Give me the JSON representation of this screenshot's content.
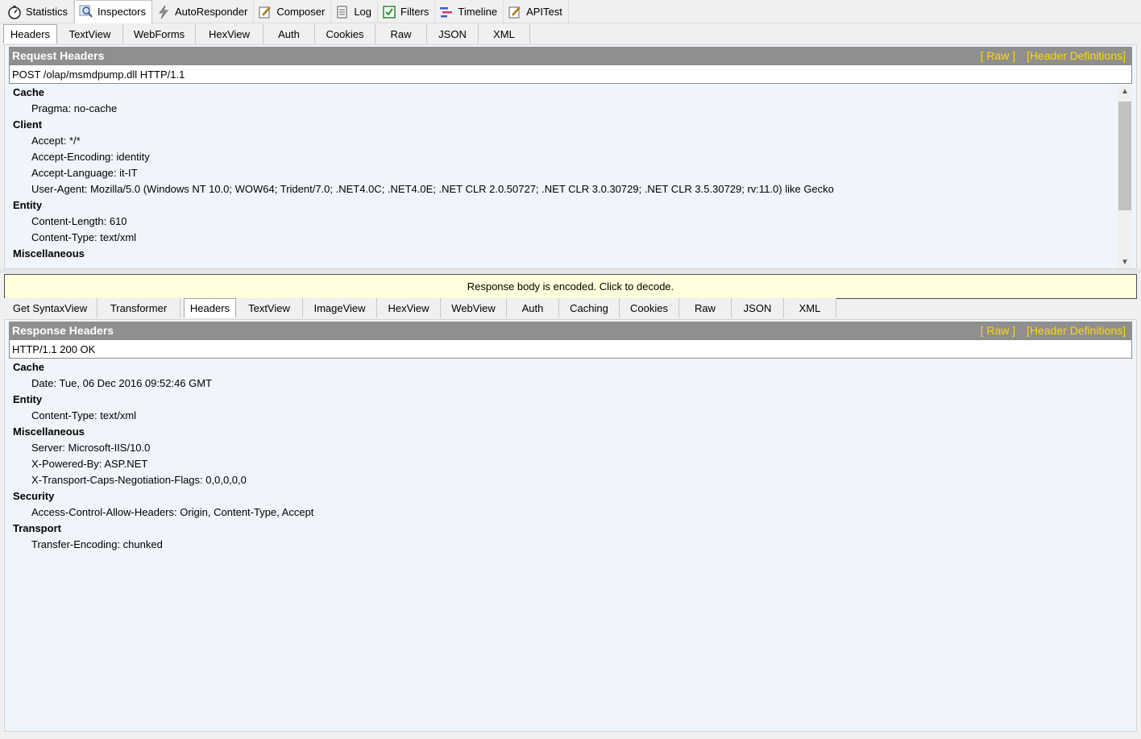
{
  "main_tabs": [
    {
      "label": "Statistics",
      "icon": "stopwatch-icon"
    },
    {
      "label": "Inspectors",
      "icon": "magnifier-icon"
    },
    {
      "label": "AutoResponder",
      "icon": "lightning-icon"
    },
    {
      "label": "Composer",
      "icon": "pencil-icon"
    },
    {
      "label": "Log",
      "icon": "log-icon"
    },
    {
      "label": "Filters",
      "icon": "checkbox-icon"
    },
    {
      "label": "Timeline",
      "icon": "timeline-icon"
    },
    {
      "label": "APITest",
      "icon": "pencil-icon"
    }
  ],
  "request_tabs": [
    "Headers",
    "TextView",
    "WebForms",
    "HexView",
    "Auth",
    "Cookies",
    "Raw",
    "JSON",
    "XML"
  ],
  "request": {
    "title": "Request Headers",
    "link_raw": "[ Raw ]",
    "link_defs": "[Header Definitions]",
    "request_line": "POST /olap/msmdpump.dll HTTP/1.1",
    "groups": [
      {
        "name": "Cache",
        "headers": [
          "Pragma: no-cache"
        ]
      },
      {
        "name": "Client",
        "headers": [
          "Accept: */*",
          "Accept-Encoding: identity",
          "Accept-Language: it-IT",
          "User-Agent: Mozilla/5.0 (Windows NT 10.0; WOW64; Trident/7.0; .NET4.0C; .NET4.0E; .NET CLR 2.0.50727; .NET CLR 3.0.30729; .NET CLR 3.5.30729; rv:11.0) like Gecko"
        ]
      },
      {
        "name": "Entity",
        "headers": [
          "Content-Length: 610",
          "Content-Type: text/xml"
        ]
      },
      {
        "name": "Miscellaneous",
        "headers": []
      }
    ]
  },
  "decode_message": "Response body is encoded. Click to decode.",
  "response_tabs": [
    "Get SyntaxView",
    "Transformer",
    "Headers",
    "TextView",
    "ImageView",
    "HexView",
    "WebView",
    "Auth",
    "Caching",
    "Cookies",
    "Raw",
    "JSON",
    "XML"
  ],
  "response": {
    "title": "Response Headers",
    "link_raw": "[ Raw ]",
    "link_defs": "[Header Definitions]",
    "status_line": "HTTP/1.1 200 OK",
    "groups": [
      {
        "name": "Cache",
        "headers": [
          "Date: Tue, 06 Dec 2016 09:52:46 GMT"
        ]
      },
      {
        "name": "Entity",
        "headers": [
          "Content-Type: text/xml"
        ]
      },
      {
        "name": "Miscellaneous",
        "headers": [
          "Server: Microsoft-IIS/10.0",
          "X-Powered-By: ASP.NET",
          "X-Transport-Caps-Negotiation-Flags: 0,0,0,0,0"
        ]
      },
      {
        "name": "Security",
        "headers": [
          "Access-Control-Allow-Headers: Origin, Content-Type, Accept"
        ]
      },
      {
        "name": "Transport",
        "headers": [
          "Transfer-Encoding: chunked"
        ]
      }
    ]
  },
  "colors": {
    "header_bar": "#8f8f8f",
    "link": "#ffd800",
    "decode_bg": "#ffffdc",
    "pane_bg": "#f0f5fb"
  }
}
